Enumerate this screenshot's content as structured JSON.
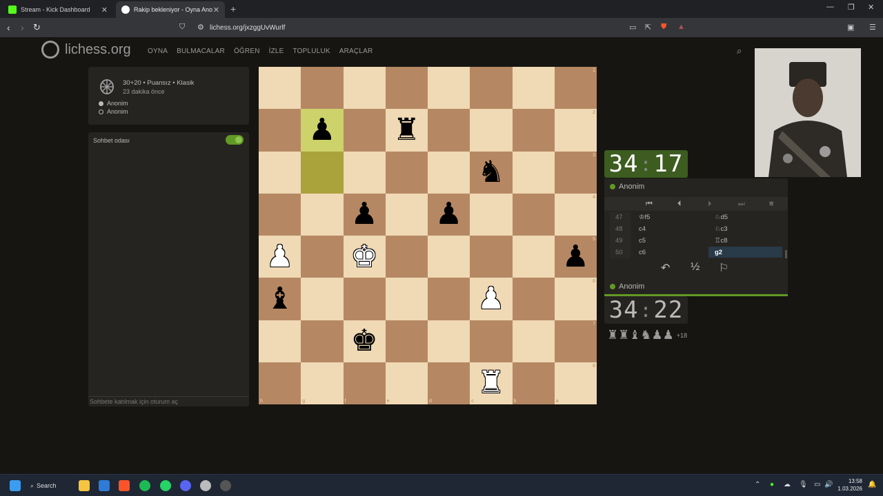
{
  "browser": {
    "tabs": [
      {
        "title": "Stream - Kick Dashboard",
        "favicon_color": "#53fc18"
      },
      {
        "title": "Rakip bekleniyor - Oyna Ano",
        "favicon_color": "#ffffff"
      }
    ],
    "url": "lichess.org/jxzggUvWurlf"
  },
  "site": {
    "logo_text": "lichess.org",
    "menu": [
      "OYNA",
      "BULMACALAR",
      "ÖĞREN",
      "İZLE",
      "TOPLULUK",
      "ARAÇLAR"
    ]
  },
  "game_info": {
    "mode": "30+20 • Puansız • Klasik",
    "started": "23 dakika önce",
    "white_player": "Anonim",
    "black_player": "Anonim"
  },
  "chat": {
    "title": "Sohbet odası",
    "footer": "Sohbete katılmak için oturum aç"
  },
  "board": {
    "orientation": "black",
    "squares": [
      [
        "",
        "",
        "",
        "",
        "",
        "",
        "",
        ""
      ],
      [
        "",
        "bp",
        "",
        "br",
        "",
        "",
        "",
        ""
      ],
      [
        "",
        "",
        "",
        "",
        "",
        "bn",
        "",
        ""
      ],
      [
        "",
        "",
        "bp",
        "",
        "bp",
        "",
        "",
        ""
      ],
      [
        "wp",
        "",
        "wk",
        "",
        "",
        "",
        "",
        "bp"
      ],
      [
        "bb",
        "",
        "",
        "",
        "",
        "wp",
        "",
        ""
      ],
      [
        "",
        "",
        "bk",
        "",
        "",
        "",
        "",
        ""
      ],
      [
        "",
        "",
        "",
        "",
        "",
        "wr",
        "",
        ""
      ]
    ],
    "highlight": [
      [
        1,
        1
      ],
      [
        2,
        1
      ]
    ],
    "rank_labels": [
      "1",
      "2",
      "3",
      "4",
      "5",
      "6",
      "7",
      "8"
    ],
    "file_labels": [
      "h",
      "g",
      "f",
      "e",
      "d",
      "c",
      "b",
      "a"
    ]
  },
  "clocks": {
    "top": {
      "min": "34",
      "sec": "17"
    },
    "bottom": {
      "min": "34",
      "sec": "22"
    }
  },
  "players": {
    "top": "Anonim",
    "bottom": "Anonim"
  },
  "moves": [
    {
      "n": "47",
      "w": "♔f5",
      "b": "♘d5"
    },
    {
      "n": "48",
      "w": "c4",
      "b": "♘c3"
    },
    {
      "n": "49",
      "w": "c5",
      "b": "♖c8"
    },
    {
      "n": "50",
      "w": "c6",
      "b": "g2"
    }
  ],
  "captured": {
    "pieces": "♜♜♝♞♟♟",
    "plus": "+18"
  },
  "taskbar": {
    "search": "Search",
    "time": "13:58",
    "date": "1.03.2026"
  }
}
